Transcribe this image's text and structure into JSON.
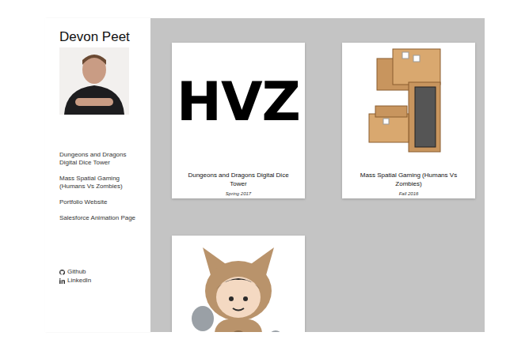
{
  "sidebar": {
    "name": "Devon Peet",
    "nav": [
      "Dungeons and Dragons Digital Dice Tower",
      "Mass Spatial Gaming (Humans Vs Zombies)",
      "Portfolio Website",
      "Salesforce Animation Page"
    ],
    "links": [
      "Github",
      "LinkedIn"
    ]
  },
  "cards": [
    {
      "kind": "logo",
      "logo": "HVZ",
      "title": "Dungeons and Dragons Digital Dice Tower",
      "date": "Spring 2017"
    },
    {
      "kind": "photo",
      "title": "Mass Spatial Gaming (Humans Vs Zombies)",
      "date": "Fall 2016"
    },
    {
      "kind": "illustration"
    }
  ]
}
